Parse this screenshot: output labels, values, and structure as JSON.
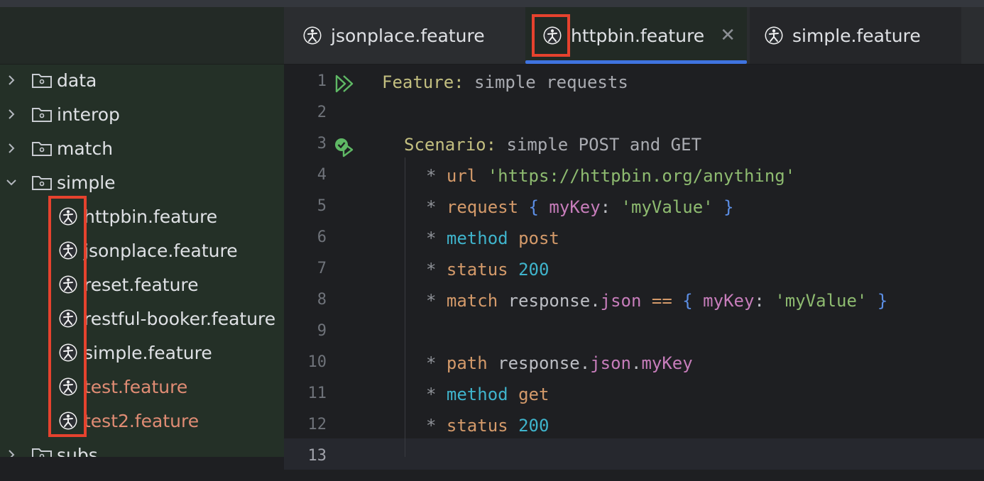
{
  "sidebar": {
    "folders": [
      {
        "label": "data",
        "expanded": false
      },
      {
        "label": "interop",
        "expanded": false
      },
      {
        "label": "match",
        "expanded": false
      },
      {
        "label": "simple",
        "expanded": true
      },
      {
        "label": "subs",
        "expanded": false
      }
    ],
    "files": [
      {
        "label": "httpbin.feature",
        "modified": false
      },
      {
        "label": "jsonplace.feature",
        "modified": false
      },
      {
        "label": "reset.feature",
        "modified": false
      },
      {
        "label": "restful-booker.feature",
        "modified": false
      },
      {
        "label": "simple.feature",
        "modified": false
      },
      {
        "label": "test.feature",
        "modified": true
      },
      {
        "label": "test2.feature",
        "modified": true
      }
    ]
  },
  "tabs": [
    {
      "label": "jsonplace.feature",
      "active": false
    },
    {
      "label": "httpbin.feature",
      "active": true
    },
    {
      "label": "simple.feature",
      "active": false
    }
  ],
  "editor": {
    "line_numbers": [
      "1",
      "2",
      "3",
      "4",
      "5",
      "6",
      "7",
      "8",
      "9",
      "10",
      "11",
      "12",
      "13"
    ],
    "lines": {
      "l1": {
        "kw": "Feature:",
        "text": " simple requests"
      },
      "l3": {
        "kw": "Scenario:",
        "text": " simple POST and GET"
      },
      "l4": {
        "star": "* ",
        "step": "url",
        "rest": " ",
        "str": "'https://httpbin.org/anything'"
      },
      "l5": {
        "star": "* ",
        "step": "request",
        "b1": "{",
        "prop": "myKey",
        "colon": ":",
        "str": "'myValue'",
        "b2": "}"
      },
      "l6": {
        "star": "* ",
        "step": "method",
        "arg": "post"
      },
      "l7": {
        "star": "* ",
        "step": "status",
        "num": "200"
      },
      "l8": {
        "star": "* ",
        "step": "match",
        "plain": "response.",
        "prop1": "json",
        "eq": "==",
        "b1": "{",
        "prop": "myKey",
        "colon": ":",
        "str": "'myValue'",
        "b2": "}"
      },
      "l10": {
        "star": "* ",
        "step": "path",
        "plain": "response.",
        "prop1": "json",
        "dot": ".",
        "prop2": "myKey"
      },
      "l11": {
        "star": "* ",
        "step": "method",
        "arg": "get"
      },
      "l12": {
        "star": "* ",
        "step": "status",
        "num": "200"
      }
    }
  },
  "colors": {
    "highlight": "#e6422e",
    "active_tab_underline": "#3f73e0",
    "run_icon": "#5fb865"
  },
  "icons": [
    "chevron-right-icon",
    "chevron-down-icon",
    "folder-icon",
    "karate-feature-icon",
    "close-icon",
    "run-feature-icon",
    "run-scenario-passed-icon"
  ]
}
